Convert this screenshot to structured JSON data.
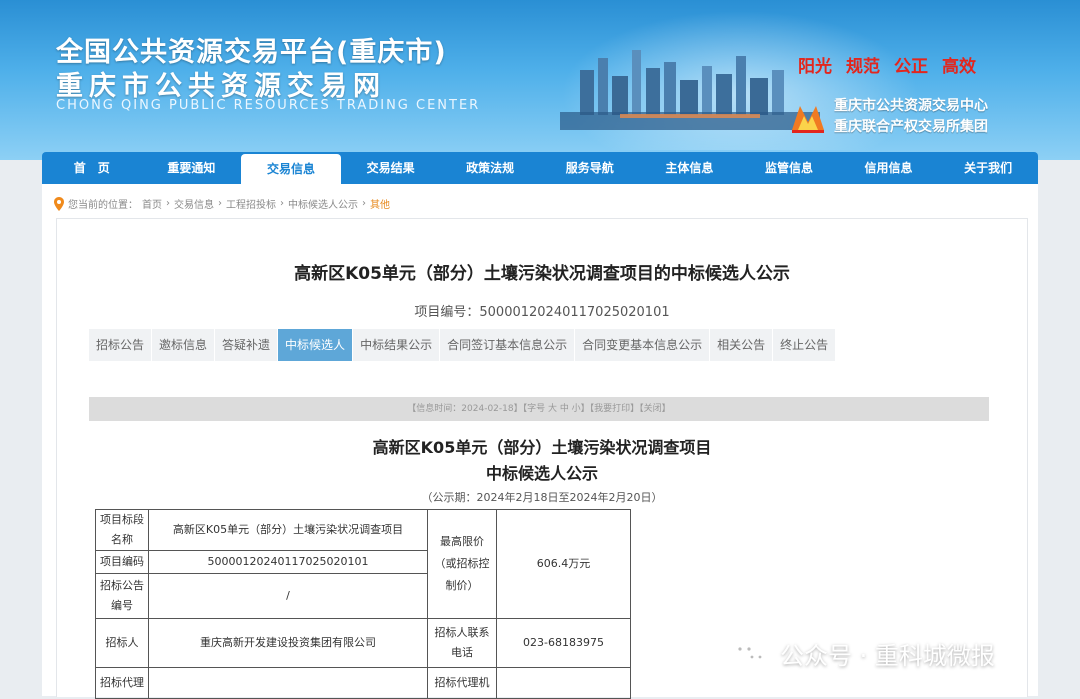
{
  "header": {
    "title": "全国公共资源交易平台(重庆市)",
    "subtitle": "重庆市公共资源交易网",
    "english": "CHONG QING PUBLIC RESOURCES TRADING CENTER",
    "slogans": [
      "阳光",
      "规范",
      "公正",
      "高效"
    ],
    "org_line1": "重庆市公共资源交易中心",
    "org_line2": "重庆联合产权交易所集团"
  },
  "nav": {
    "items": [
      "首　页",
      "重要通知",
      "交易信息",
      "交易结果",
      "政策法规",
      "服务导航",
      "主体信息",
      "监管信息",
      "信用信息",
      "关于我们"
    ],
    "active": 2
  },
  "breadcrumb": {
    "prefix": "您当前的位置：",
    "items": [
      "首页",
      "交易信息",
      "工程招投标",
      "中标候选人公示",
      "其他"
    ]
  },
  "document": {
    "title": "高新区K05单元（部分）土壤污染状况调查项目的中标候选人公示",
    "project_no": "项目编号：500001202401170250201​01"
  },
  "tabs": {
    "items": [
      "招标公告",
      "邀标信息",
      "答疑补遗",
      "中标候选人",
      "中标结果公示",
      "合同签订基本信息公示",
      "合同变更基本信息公示",
      "相关公告",
      "终止公告"
    ],
    "active": 3
  },
  "infobar": "【信息时间：2024-02-18】【字号 大 中 小】【我要打印】【关闭】",
  "announcement": {
    "title_line1": "高新区K05单元（部分）土壤污染状况调查项目",
    "title_line2": "中标候选人公示",
    "period": "（公示期：2024年2月18日至2024年2月20日）"
  },
  "table": {
    "r1_label": "项目标段名称",
    "r1_value": "高新区K05单元（部分）土壤污染状况调查项目",
    "r2_label": "项目编码",
    "r2_value": "500001202401170250201​01",
    "r3_label": "招标公告编号",
    "r3_value": "/",
    "limit_label": "最高限价（或招标控制价）",
    "limit_value": "606.4万元",
    "r4_label": "招标人",
    "r4_value": "重庆高新开发建设投资集团有限公司",
    "contact_label": "招标人联系电话",
    "contact_value": "023-68183975",
    "r5_label": "招标代理",
    "r5_value": "",
    "r5_right_label": "招标代理机",
    "r5_right_value": ""
  },
  "watermark": "公众号 · 重科城微报",
  "colors": {
    "nav_blue": "#1a84d3",
    "slogan_red": "#e3261d",
    "active_tab": "#5ea7d8"
  }
}
